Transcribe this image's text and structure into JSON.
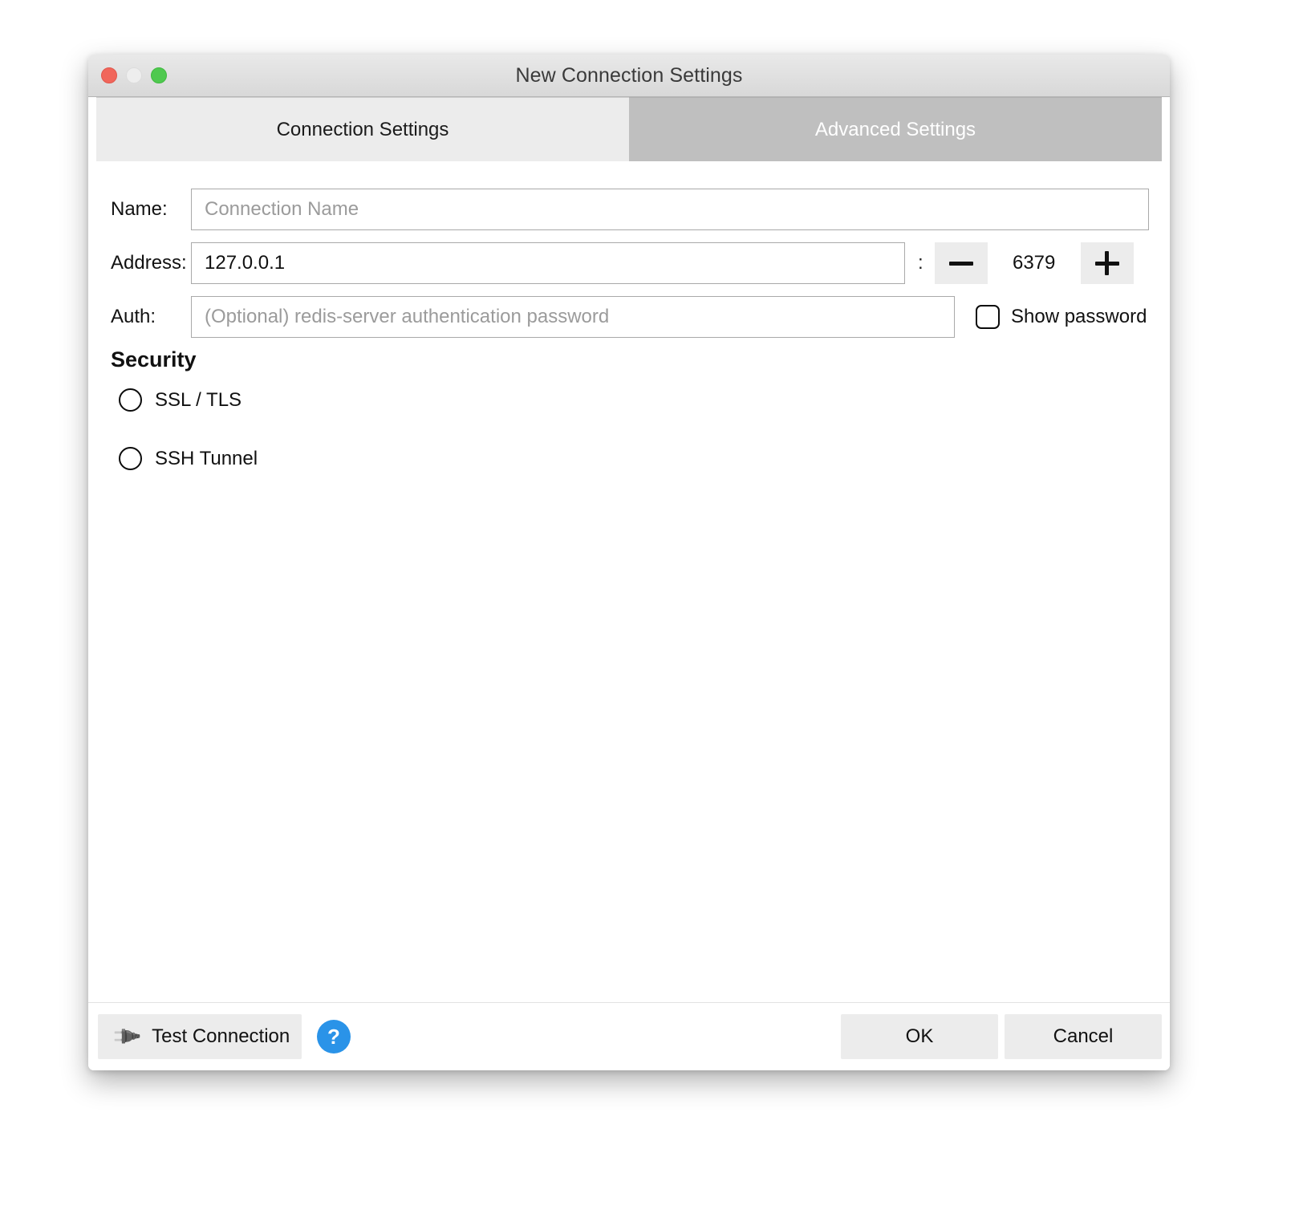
{
  "window": {
    "title": "New Connection Settings",
    "controls": {
      "close": "close-button",
      "minimize": "minimize-button",
      "maximize": "maximize-button"
    }
  },
  "tabs": [
    {
      "label": "Connection Settings",
      "active": false
    },
    {
      "label": "Advanced Settings",
      "active": true
    }
  ],
  "form": {
    "name": {
      "label": "Name:",
      "value": "",
      "placeholder": "Connection Name"
    },
    "address": {
      "label": "Address:",
      "value": "127.0.0.1",
      "placeholder": "127.0.0.1"
    },
    "separator": ":",
    "port": {
      "value": "6379",
      "decrement": "—",
      "increment": "+"
    },
    "auth": {
      "label": "Auth:",
      "value": "",
      "placeholder": "(Optional) redis-server authentication password"
    },
    "show_password": {
      "label": "Show password",
      "checked": false
    }
  },
  "security": {
    "title": "Security",
    "options": [
      {
        "label": "SSL / TLS",
        "selected": false
      },
      {
        "label": "SSH Tunnel",
        "selected": false
      }
    ]
  },
  "footer": {
    "test_connection": "Test Connection",
    "help": "?",
    "ok": "OK",
    "cancel": "Cancel"
  },
  "colors": {
    "accent_blue": "#2a93e8",
    "tab_active_bg": "#bfbfbf",
    "tab_inactive_bg": "#ececec",
    "close_red": "#f1665b",
    "maximize_green": "#4fc94f",
    "minimize_gray": "#eeeeee",
    "button_bg": "#ececec"
  }
}
